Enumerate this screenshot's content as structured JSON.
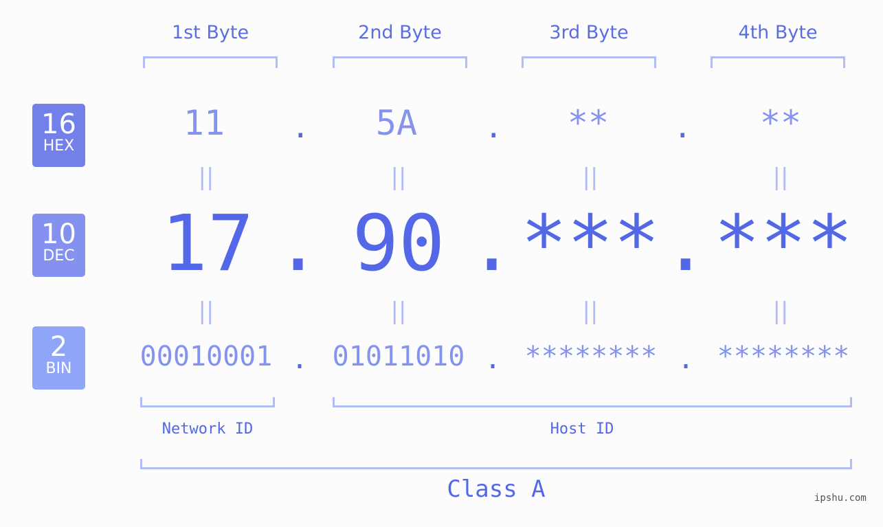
{
  "badges": [
    {
      "base": "16",
      "label": "HEX",
      "color": "#7380ea"
    },
    {
      "base": "10",
      "label": "DEC",
      "color": "#8491ef"
    },
    {
      "base": "2",
      "label": "BIN",
      "color": "#8fa5f7"
    }
  ],
  "byte_headers": [
    "1st Byte",
    "2nd Byte",
    "3rd Byte",
    "4th Byte"
  ],
  "hex": [
    "11",
    "5A",
    "**",
    "**"
  ],
  "dec": [
    "17",
    "90",
    "***",
    "***"
  ],
  "bin": [
    "00010001",
    "01011010",
    "********",
    "********"
  ],
  "separator": ".",
  "equals": "||",
  "network_id_label": "Network ID",
  "host_id_label": "Host ID",
  "class_label": "Class A",
  "watermark": "ipshu.com",
  "colors": {
    "primary": "#5468e7",
    "light": "#8592ee",
    "bracket": "#b3bdf5"
  }
}
